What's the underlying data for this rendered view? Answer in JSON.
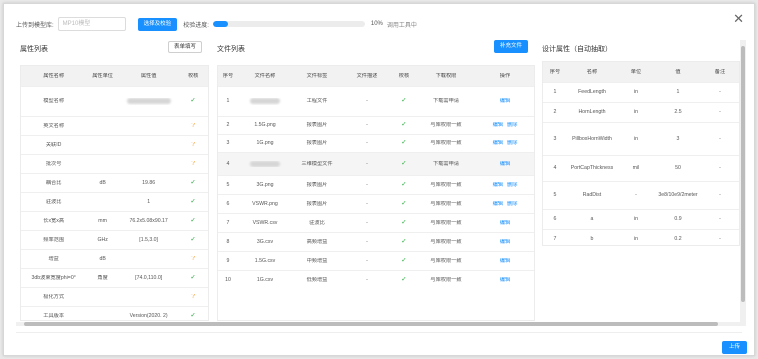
{
  "toolbar": {
    "upload_label": "上传到模型库:",
    "model_placeholder": "MP10模型",
    "select_button": "选择及校验",
    "progress_label": "校验进度:",
    "progress_percent": "10%",
    "progress_value": 0.1,
    "progress_status": "调用工具中"
  },
  "accent_color": "#1890ff",
  "attr_panel": {
    "title": "属性列表",
    "fill_button": "表单填写",
    "headers": [
      "属性名称",
      "属性单位",
      "属性值",
      "校核"
    ],
    "rows": [
      {
        "name": "模型名称",
        "unit": "",
        "value": "",
        "check": "ok"
      },
      {
        "name": "英文名称",
        "unit": "",
        "value": "",
        "check": "pending"
      },
      {
        "name": "关联ID",
        "unit": "",
        "value": "",
        "check": "pending"
      },
      {
        "name": "批次号",
        "unit": "",
        "value": "",
        "check": "pending"
      },
      {
        "name": "耦合比",
        "unit": "dB",
        "value": "19.86",
        "check": "ok"
      },
      {
        "name": "驻波比",
        "unit": "",
        "value": "1",
        "check": "ok"
      },
      {
        "name": "长x宽x高",
        "unit": "mm",
        "value": "76.2x5.08x90.17",
        "check": "ok"
      },
      {
        "name": "频率范围",
        "unit": "GHz",
        "value": "[1.5,3.0]",
        "check": "ok"
      },
      {
        "name": "增益",
        "unit": "dB",
        "value": "",
        "check": "pending"
      },
      {
        "name": "3db波束宽度phi=0°",
        "unit": "角度",
        "value": "[74.0,110.0]",
        "check": "ok"
      },
      {
        "name": "极化方式",
        "unit": "",
        "value": "",
        "check": "pending"
      },
      {
        "name": "工具版本",
        "unit": "",
        "value": "Version(2020. 2)",
        "check": "ok"
      }
    ]
  },
  "file_panel": {
    "title": "文件列表",
    "add_button": "补充文件",
    "headers": [
      "序号",
      "文件名称",
      "文件标签",
      "文件描述",
      "校核",
      "下载权限",
      "操作"
    ],
    "rows": [
      {
        "no": "1",
        "name": "",
        "tag": "工程文件",
        "desc": "-",
        "perm": "下载需申请",
        "ops": [
          "编辑"
        ]
      },
      {
        "no": "2",
        "name": "1.5G.png",
        "tag": "报表图片",
        "desc": "-",
        "perm": "与库权限一致",
        "ops": [
          "编辑",
          "删除"
        ]
      },
      {
        "no": "3",
        "name": "1G.png",
        "tag": "报表图片",
        "desc": "-",
        "perm": "与库权限一致",
        "ops": [
          "编辑",
          "删除"
        ]
      },
      {
        "no": "4",
        "name": "",
        "tag": "三维模型文件",
        "desc": "-",
        "perm": "下载需申请",
        "ops": [
          "编辑"
        ]
      },
      {
        "no": "5",
        "name": "3G.png",
        "tag": "报表图片",
        "desc": "-",
        "perm": "与库权限一致",
        "ops": [
          "编辑",
          "删除"
        ]
      },
      {
        "no": "6",
        "name": "VSWR.png",
        "tag": "报表图片",
        "desc": "-",
        "perm": "与库权限一致",
        "ops": [
          "编辑",
          "删除"
        ]
      },
      {
        "no": "7",
        "name": "VSWR.csv",
        "tag": "驻波比",
        "desc": "-",
        "perm": "与库权限一致",
        "ops": [
          "编辑"
        ]
      },
      {
        "no": "8",
        "name": "3G.csv",
        "tag": "高频增益",
        "desc": "-",
        "perm": "与库权限一致",
        "ops": [
          "编辑"
        ]
      },
      {
        "no": "9",
        "name": "1.5G.csv",
        "tag": "中频增益",
        "desc": "-",
        "perm": "与库权限一致",
        "ops": [
          "编辑"
        ]
      },
      {
        "no": "10",
        "name": "1G.csv",
        "tag": "低频增益",
        "desc": "-",
        "perm": "与库权限一致",
        "ops": [
          "编辑"
        ]
      }
    ]
  },
  "design_panel": {
    "title": "设计属性（自动抽取）",
    "headers": [
      "序号",
      "名称",
      "单位",
      "值",
      "备注"
    ],
    "rows": [
      {
        "no": "1",
        "name": "FeedLength",
        "unit": "in",
        "value": "1",
        "note": "-"
      },
      {
        "no": "2",
        "name": "HornLength",
        "unit": "in",
        "value": "2.5",
        "note": "-"
      },
      {
        "no": "3",
        "name": "PillboxHornWidth",
        "unit": "in",
        "value": "3",
        "note": "-"
      },
      {
        "no": "4",
        "name": "PortCapThickness",
        "unit": "mil",
        "value": "50",
        "note": "-"
      },
      {
        "no": "5",
        "name": "RadDist",
        "unit": "-",
        "value": "3e8/10e9/2meter",
        "note": "-"
      },
      {
        "no": "6",
        "name": "a",
        "unit": "in",
        "value": "0.9",
        "note": "-"
      },
      {
        "no": "7",
        "name": "b",
        "unit": "in",
        "value": "0.2",
        "note": "-"
      }
    ]
  },
  "footer": {
    "upload_button": "上传"
  }
}
